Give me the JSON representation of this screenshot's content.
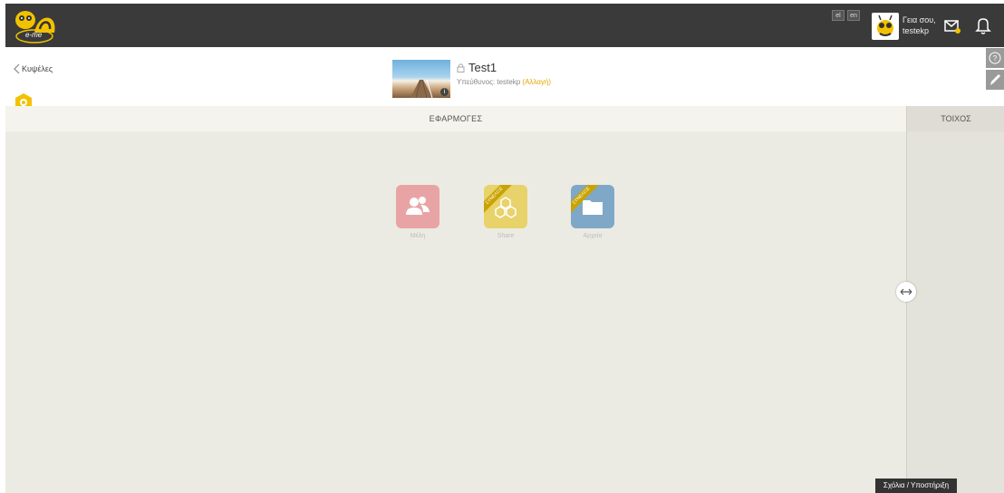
{
  "topbar": {
    "logo_text": "e-me",
    "lang_el": "el",
    "lang_en": "en",
    "greeting": "Γεια σου,",
    "username": "testekp"
  },
  "header": {
    "back_label": "Κυψέλες",
    "space_title": "Test1",
    "owner_prefix": "Υπεύθυνος: testekp",
    "owner_change": "(Αλλαγή)"
  },
  "main": {
    "tab_title": "ΕΦΑΡΜΟΓΕΣ",
    "apps": [
      {
        "label": "Μέλη",
        "color": "#e8a4a4"
      },
      {
        "label": "Share",
        "color": "#e8d26a",
        "ribbon": "ΣΥΝΕΛΙΞΕ"
      },
      {
        "label": "Αρχεία",
        "color": "#7fa8c8",
        "ribbon": "ΣΥΝΕΛΙΞΕ"
      }
    ]
  },
  "wall": {
    "title": "ΤΟΙΧΟΣ"
  },
  "feedback_label": "Σχόλια / Υποστήριξη",
  "colors": {
    "topbar": "#3a3a3a",
    "accent": "#f2c200",
    "main_bg": "#ecebe3"
  }
}
